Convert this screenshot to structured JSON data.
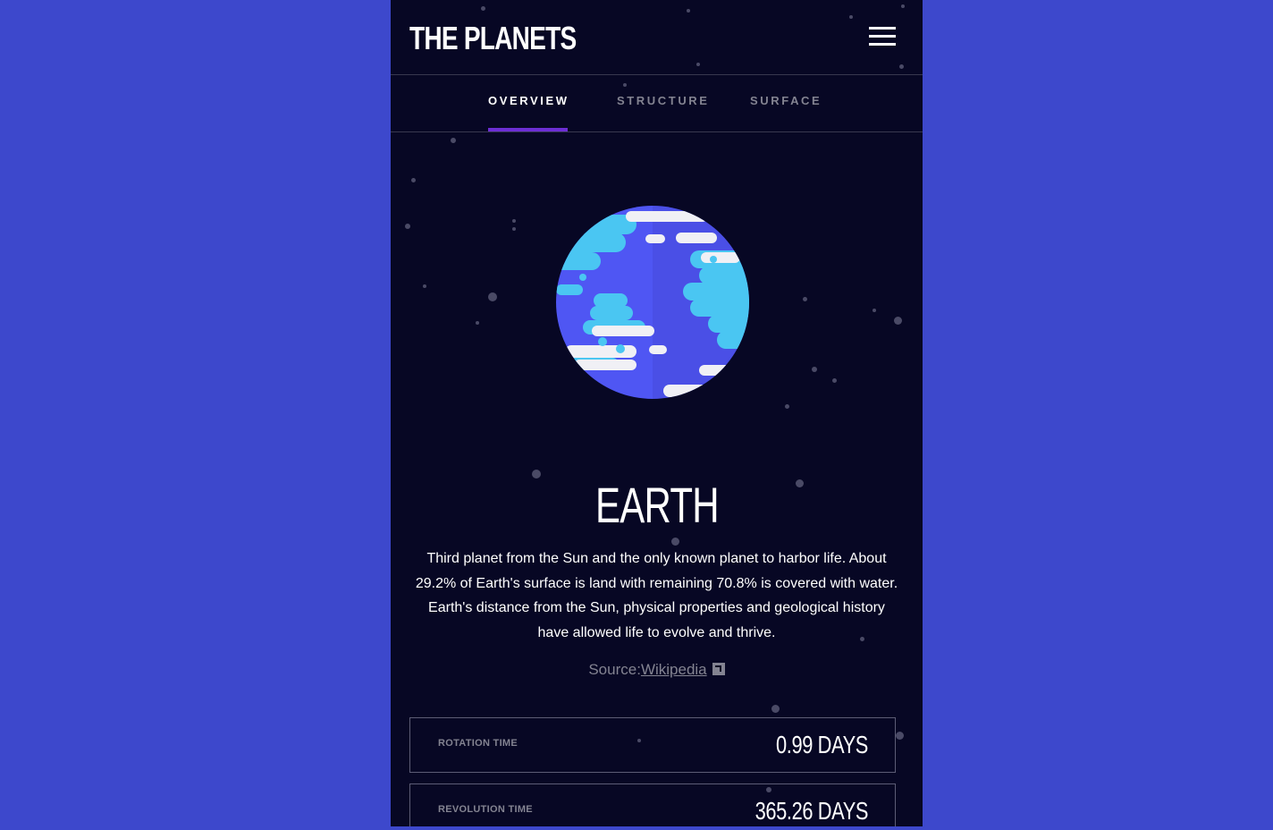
{
  "header": {
    "logo": "THE PLANETS",
    "menu_icon": "hamburger-icon"
  },
  "tabs": [
    {
      "label": "OVERVIEW",
      "active": true
    },
    {
      "label": "STRUCTURE",
      "active": false
    },
    {
      "label": "SURFACE",
      "active": false
    }
  ],
  "planet": {
    "name": "EARTH",
    "description": "Third planet from the Sun and the only known planet to harbor life. About 29.2% of Earth's surface is land with remaining 70.8% is covered with water. Earth's distance from the Sun, physical properties and geological history have allowed life to evolve and thrive.",
    "source_prefix": "Source:",
    "source_link": "Wikipedia",
    "source_icon": "external-link-icon"
  },
  "stats": [
    {
      "label": "ROTATION TIME",
      "value": "0.99 DAYS"
    },
    {
      "label": "REVOLUTION TIME",
      "value": "365.26 DAYS"
    }
  ],
  "colors": {
    "background": "#070724",
    "page": "#3d48cc",
    "accent": "#6d2ed5"
  }
}
